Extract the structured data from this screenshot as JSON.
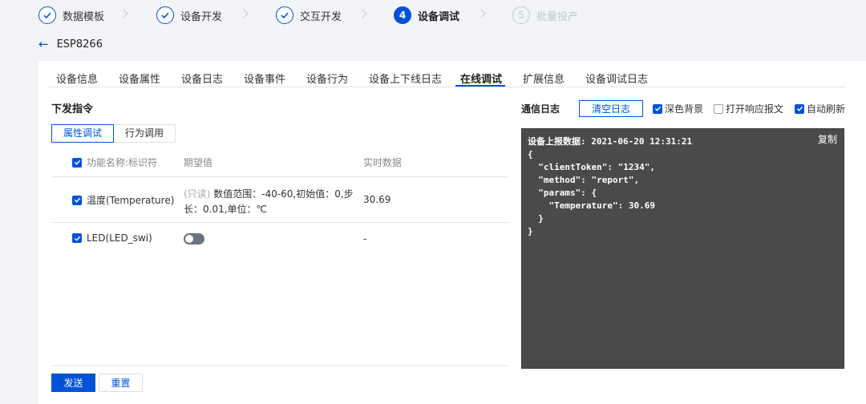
{
  "steps": [
    {
      "label": "数据模板",
      "state": "done"
    },
    {
      "label": "设备开发",
      "state": "done"
    },
    {
      "label": "交互开发",
      "state": "done"
    },
    {
      "label": "设备调试",
      "state": "active",
      "number": "4"
    },
    {
      "label": "批量投产",
      "state": "pending",
      "number": "5"
    }
  ],
  "breadcrumb": {
    "device_name": "ESP8266"
  },
  "tabs": [
    "设备信息",
    "设备属性",
    "设备日志",
    "设备事件",
    "设备行为",
    "设备上下线日志",
    "在线调试",
    "扩展信息",
    "设备调试日志"
  ],
  "active_tab": "在线调试",
  "left_panel": {
    "title": "下发指令",
    "subtabs": [
      "属性调试",
      "行为调用"
    ],
    "headers": {
      "name": "功能名称:标识符",
      "expected": "期望值",
      "realtime": "实时数据"
    },
    "rows": [
      {
        "name": "温度(Temperature)",
        "readonly": "(只读)",
        "desc": "数值范围：-40-60,初始值：0,步长：0.01,单位：℃",
        "value": "30.69"
      },
      {
        "name": "LED(LED_swi)",
        "value": "-"
      }
    ],
    "send_label": "发送",
    "reset_label": "重置"
  },
  "right_panel": {
    "title": "通信日志",
    "clear_label": "清空日志",
    "options": [
      {
        "label": "深色背景",
        "checked": true
      },
      {
        "label": "打开响应报文",
        "checked": false
      },
      {
        "label": "自动刷新",
        "checked": true
      }
    ],
    "copy_label": "复制",
    "log_text": "设备上报数据: 2021-06-20 12:31:21\n{\n  \"clientToken\": \"1234\",\n  \"method\": \"report\",\n  \"params\": {\n    \"Temperature\": 30.69\n  }\n}"
  },
  "colors": {
    "accent": "#0052d9",
    "console_bg": "#4a4a4a"
  }
}
